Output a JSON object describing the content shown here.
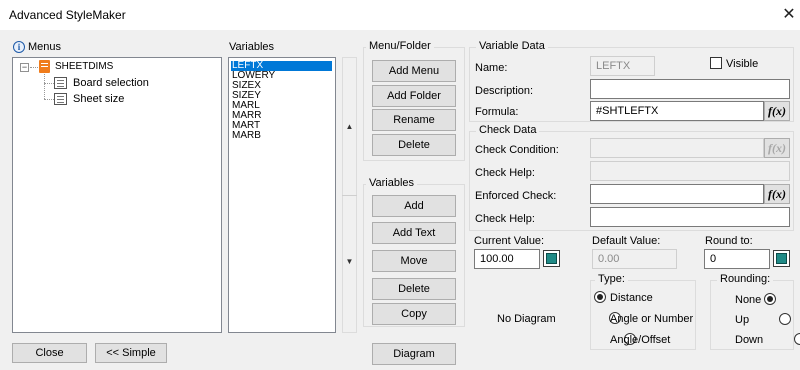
{
  "window": {
    "title": "Advanced StyleMaker",
    "close_glyph": "✕"
  },
  "menus": {
    "label": "Menus",
    "info_icon": "info-icon",
    "root": {
      "label": "SHEETDIMS",
      "expander": "⊟"
    },
    "children": [
      {
        "label": "Board selection"
      },
      {
        "label": "Sheet size"
      }
    ]
  },
  "variables": {
    "label": "Variables",
    "items": [
      "LEFTX",
      "LOWERY",
      "SIZEX",
      "SIZEY",
      "MARL",
      "MARR",
      "MART",
      "MARB"
    ],
    "selected_index": 0
  },
  "menu_folder": {
    "label": "Menu/Folder",
    "buttons": {
      "add_menu": "Add Menu",
      "add_folder": "Add Folder",
      "rename": "Rename",
      "delete": "Delete"
    }
  },
  "variables_group": {
    "label": "Variables",
    "buttons": {
      "add": "Add",
      "add_text": "Add Text",
      "move": "Move",
      "delete": "Delete",
      "copy": "Copy"
    }
  },
  "variable_data": {
    "label": "Variable Data",
    "name_label": "Name:",
    "name_value": "LEFTX",
    "visible_label": "Visible",
    "visible_checked": false,
    "description_label": "Description:",
    "description_value": "",
    "formula_label": "Formula:",
    "formula_value": "#SHTLEFTX",
    "fx_label": "f(x)"
  },
  "check_data": {
    "label": "Check Data",
    "check_condition_label": "Check Condition:",
    "check_condition_value": "",
    "check_help_label": "Check Help:",
    "check_help_value": "",
    "enforced_check_label": "Enforced Check:",
    "enforced_check_value": "",
    "check_help2_label": "Check Help:",
    "check_help2_value": "",
    "fx_label": "f(x)"
  },
  "values": {
    "current_label": "Current Value:",
    "current_value": "100.00",
    "default_label": "Default Value:",
    "default_value": "0.00",
    "round_label": "Round to:",
    "round_value": "0"
  },
  "type": {
    "label": "Type:",
    "options": [
      "Distance",
      "Angle or Number",
      "Angle/Offset"
    ],
    "selected": "Distance"
  },
  "rounding": {
    "label": "Rounding:",
    "options": [
      "None",
      "Up",
      "Down"
    ],
    "selected": "None"
  },
  "diagram": {
    "no_diagram_text": "No Diagram",
    "button": "Diagram"
  },
  "footer": {
    "close": "Close",
    "simple": "<< Simple"
  },
  "colors": {
    "selection": "#0078d7",
    "calc_icon": "#1f8a86",
    "folder_icon": "#f07c1c"
  }
}
